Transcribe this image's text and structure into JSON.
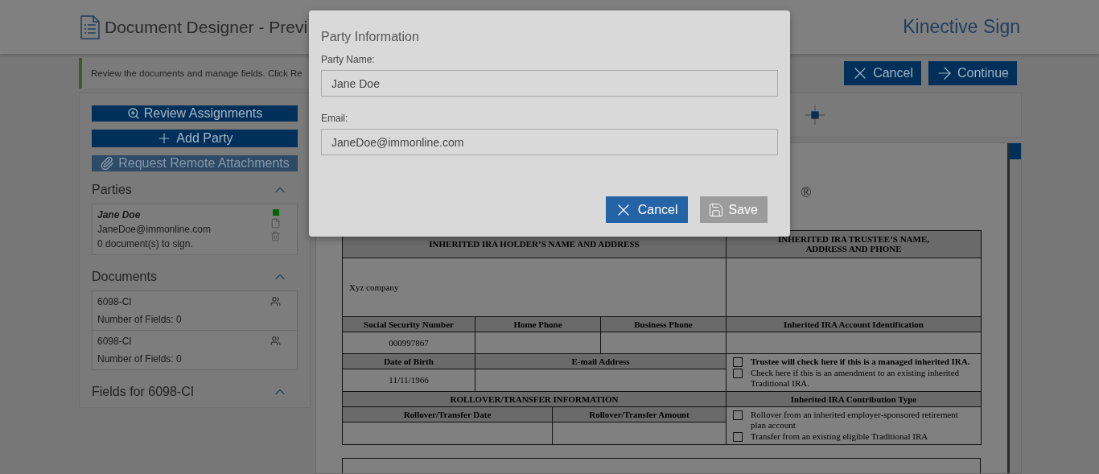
{
  "header": {
    "title": "Document Designer - Previ",
    "brand": "Kinective Sign"
  },
  "banner": {
    "text": "Review the documents and manage fields. Click Re"
  },
  "actions": [
    {
      "label": "Cancel",
      "kind": "cancel"
    },
    {
      "label": "Continue",
      "kind": "continue"
    }
  ],
  "sidebar": {
    "buttons": [
      {
        "label": "Review Assignments",
        "kind": "review",
        "disabled": false
      },
      {
        "label": "Add Party",
        "kind": "add",
        "disabled": false
      },
      {
        "label": "Request Remote Attachments",
        "kind": "attach",
        "disabled": true
      }
    ],
    "sections": [
      {
        "title": "Parties",
        "kind": "parties",
        "expanded": true,
        "items": [
          {
            "name": "Jane Doe",
            "email": "JaneDoe@immonline.com",
            "summary": "0 document(s) to sign.",
            "color": "#006400"
          }
        ]
      },
      {
        "title": "Documents",
        "kind": "documents",
        "expanded": true,
        "items": [
          {
            "name": "6098-CI",
            "fields": "Number of Fields: 0"
          },
          {
            "name": "6098-CI",
            "fields": "Number of Fields: 0"
          }
        ]
      },
      {
        "title": "Fields for 6098-CI",
        "expanded": true
      }
    ]
  },
  "toolbar": {
    "view_tools": [
      {
        "kind": "move"
      }
    ]
  },
  "document": {
    "title_mark": "®",
    "form": {
      "holder_heading": "INHERITED IRA HOLDER’S NAME AND ADDRESS",
      "trustee_heading": [
        "INHERITED IRA TRUSTEE’S NAME,",
        "ADDRESS AND PHONE"
      ],
      "holder_value": "Xyz company",
      "ssn": {
        "label": "Social Security Number",
        "value": "000997867"
      },
      "home_phone": {
        "label": "Home Phone"
      },
      "business_phone": {
        "label": "Business Phone"
      },
      "account_id": {
        "label": "Inherited IRA Account Identification"
      },
      "dob": {
        "label": "Date of Birth",
        "value": "11/11/1966"
      },
      "email": {
        "label": "E-mail Address"
      },
      "trustee_options": [
        {
          "text": "Trustee will check here if this is a managed inherited IRA.",
          "bold": true,
          "checked": false
        },
        {
          "text": "Check here if this is an amendment to an existing inherited Traditional IRA.",
          "bold": false,
          "checked": false
        }
      ],
      "rollover_heading": "ROLLOVER/TRANSFER INFORMATION",
      "contribution_heading": "Inherited IRA Contribution Type",
      "rollover_date": {
        "label": "Rollover/Transfer Date"
      },
      "rollover_amount": {
        "label": "Rollover/Transfer Amount"
      },
      "contribution_options": [
        {
          "text": "Rollover from an inherited employer-sponsored retirement plan account",
          "bold": false,
          "checked": false
        },
        {
          "text": "Transfer from an existing eligible Traditional IRA",
          "bold": false,
          "checked": false
        }
      ]
    }
  },
  "dialog": {
    "title": "Party Information",
    "fields": [
      {
        "label": "Party Name:",
        "value": "Jane Doe"
      },
      {
        "label": "Email:",
        "value": "JaneDoe@immonline.com"
      }
    ],
    "buttons": [
      {
        "label": "Cancel",
        "kind": "cancel"
      },
      {
        "label": "Save",
        "kind": "save"
      }
    ]
  }
}
